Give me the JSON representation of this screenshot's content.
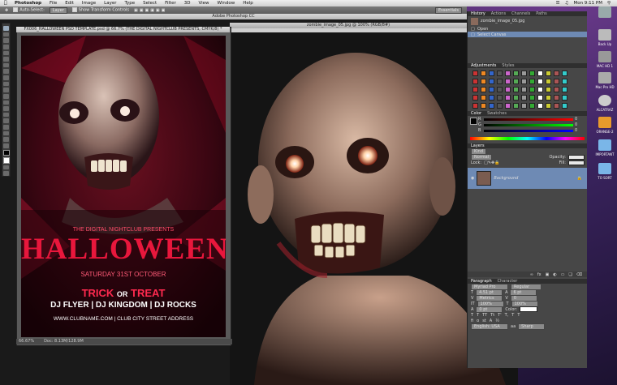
{
  "menubar": {
    "app_name": "Photoshop",
    "items": [
      "File",
      "Edit",
      "Image",
      "Layer",
      "Type",
      "Select",
      "Filter",
      "3D",
      "View",
      "Window",
      "Help"
    ],
    "clock": "Mon 9:11 PM"
  },
  "options_bar": {
    "auto_select_label": "Auto-Select:",
    "auto_select_value": "Layer",
    "show_transform_label": "Show Transform Controls",
    "workspace": "Essentials"
  },
  "app_title": "Adobe Photoshop CC",
  "doc_left": {
    "title": "FX006_HALLOWEEN PSD TEMPLATE.psd @ 66.7% (THE DIGITAL NIGHTCLUB PRESENTS, CMYK/8) *",
    "zoom": "66.67%",
    "doc_size": "Doc: 8.13M/128.9M"
  },
  "doc_right": {
    "title": "zombie_image_05.jpg @ 100% (RGB/8#)"
  },
  "poster": {
    "presents": "THE DIGITAL NIGHTCLUB PRESENTS",
    "headline": "HALLOWEEN",
    "date": "SATURDAY 31ST OCTOBER",
    "trick": "TRICK",
    "or": "OR",
    "treat": "TREAT",
    "djs": "DJ FLYER | DJ KINGDOM | DJ ROCKS",
    "address": "WWW.CLUBNAME.COM | CLUB CITY STREET ADDRESS"
  },
  "history_panel": {
    "tabs": [
      "History",
      "Actions",
      "Channels",
      "Paths"
    ],
    "snapshot": "zombie_image_05.jpg",
    "steps": [
      "Open",
      "Select Canvas"
    ]
  },
  "styles_panel": {
    "tabs": [
      "Adjustments",
      "Styles"
    ]
  },
  "color_panel": {
    "tabs": [
      "Color",
      "Swatches"
    ],
    "channels": [
      "R",
      "G",
      "B"
    ],
    "values": [
      "0",
      "0",
      "0"
    ]
  },
  "layers_panel": {
    "tabs": [
      "Layers"
    ],
    "kind_label": "Kind",
    "blend_mode": "Normal",
    "opacity_label": "Opacity:",
    "lock_label": "Lock:",
    "fill_label": "Fill:",
    "layer_name": "Background"
  },
  "character_panel": {
    "tabs": [
      "Paragraph",
      "Character"
    ],
    "font": "Myriad Pro",
    "style": "Regular",
    "size": "4.51 pt",
    "leading": "6 pt",
    "kerning": "Metrics",
    "tracking": "0",
    "vscale": "100%",
    "hscale": "100%",
    "baseline": "0 pt",
    "color_label": "Color:",
    "language": "English: USA",
    "aa_label": "aa",
    "aa_value": "Sharp"
  },
  "dock": [
    {
      "label": "",
      "icon": "drive-icon",
      "color": "#9aa"
    },
    {
      "label": "Back Up",
      "icon": "drive-icon",
      "color": "#bbb"
    },
    {
      "label": "MAC HD 1",
      "icon": "drive-icon",
      "color": "#999"
    },
    {
      "label": "Mac Pro HD",
      "icon": "drive-icon",
      "color": "#aaa"
    },
    {
      "label": "ALCATRAZ",
      "icon": "disc-icon",
      "color": "#ccc"
    },
    {
      "label": "ORANGE-2",
      "icon": "drive-icon",
      "color": "#e89a2c"
    },
    {
      "label": "IMPORTANT",
      "icon": "folder-icon",
      "color": "#7ab6e8"
    },
    {
      "label": "TO SORT",
      "icon": "folder-icon",
      "color": "#7ab6e8"
    }
  ],
  "colors": {
    "accent_red": "#e8173c",
    "layer_selected": "#6e8ab4",
    "panel_bg": "#474747"
  }
}
